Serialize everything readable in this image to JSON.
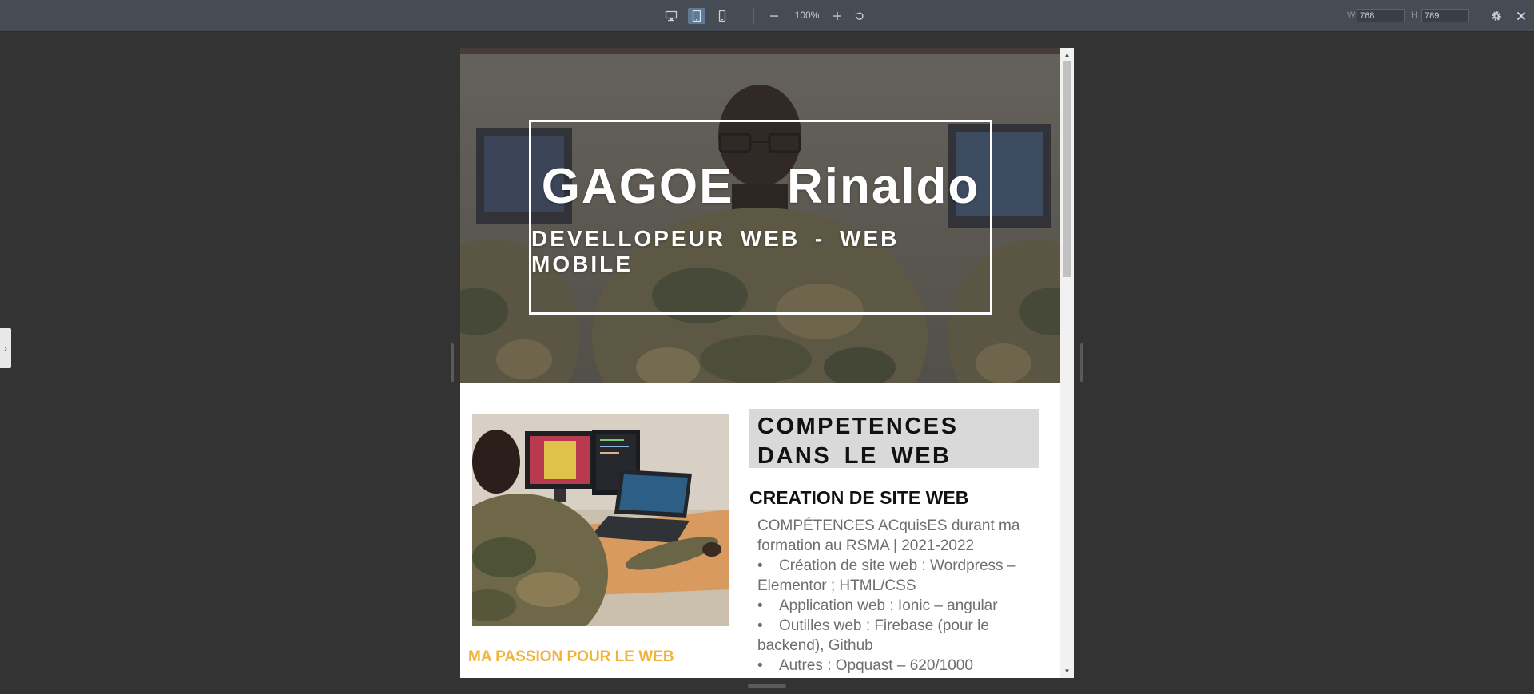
{
  "toolbar": {
    "zoom": "100%",
    "width_label": "W",
    "width_value": "768",
    "height_label": "H",
    "height_value": "789"
  },
  "site": {
    "hero": {
      "title": "GAGOE  Rinaldo",
      "subtitle": "DEVELLOPEUR WEB - WEB MOBILE"
    },
    "passion": {
      "title": "MA PASSION POUR LE WEB"
    },
    "competences": {
      "title": "COMPETENCES DANS LE WEB",
      "subtitle": "CREATION DE SITE WEB",
      "intro": "COMPÉTENCES ACquisES durant ma formation au RSMA | 2021-2022",
      "items": [
        "Création de site web : Wordpress – Elementor ; HTML/CSS",
        "Application web : Ionic – angular",
        "Outilles web : Firebase (pour le backend), Github",
        "Autres : Opquast – 620/1000"
      ]
    }
  },
  "colors": {
    "toolbar_bg": "#464c54",
    "canvas_bg": "#333333",
    "accent": "#f0b43c",
    "comp_box_bg": "#d9d9d9"
  }
}
